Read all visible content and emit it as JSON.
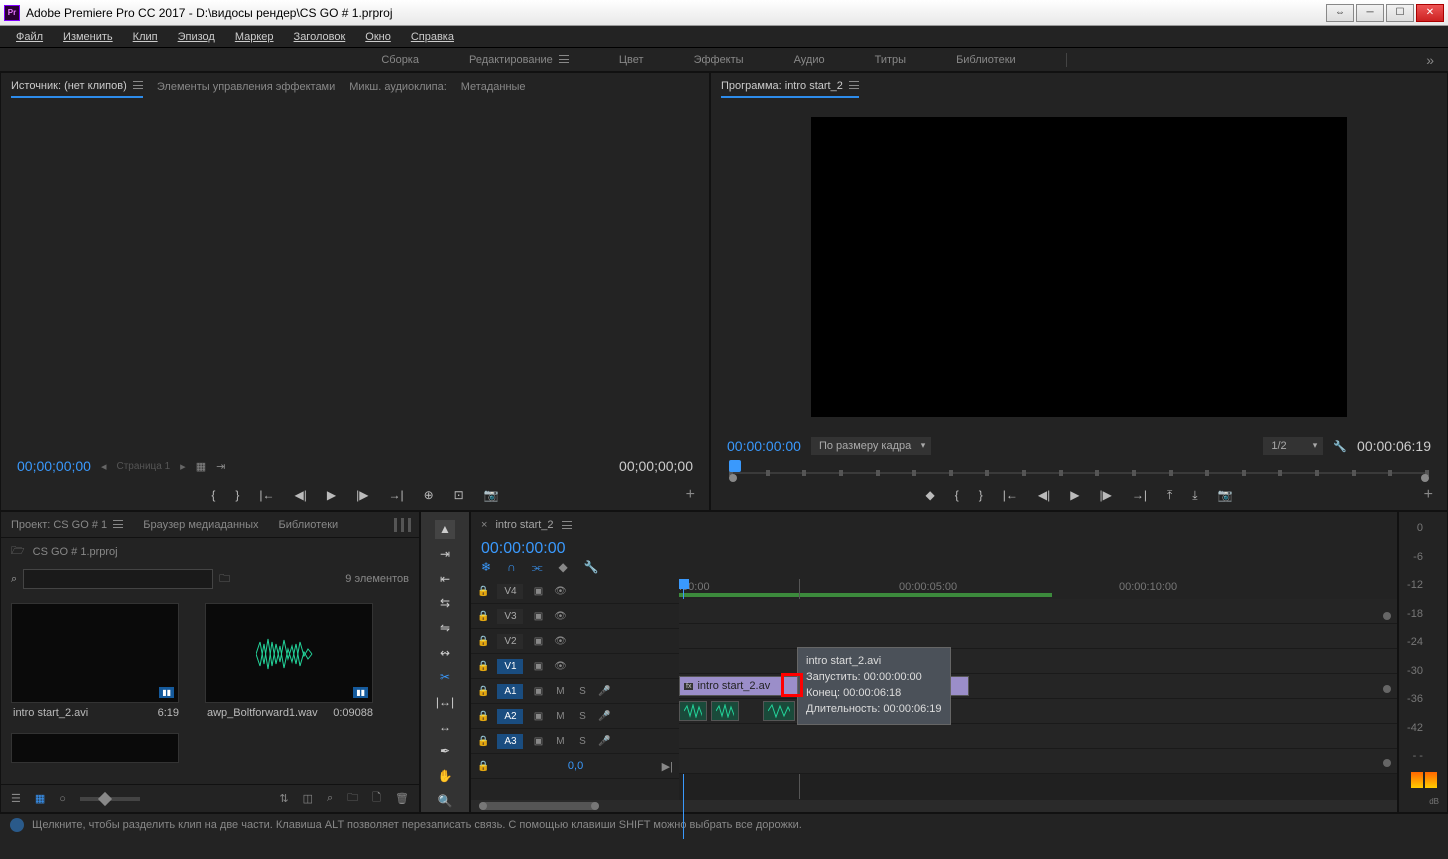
{
  "app": {
    "title": "Adobe Premiere Pro CC 2017 - D:\\видосы рендер\\CS GO # 1.prproj",
    "logo": "Pr"
  },
  "menubar": [
    "Файл",
    "Изменить",
    "Клип",
    "Эпизод",
    "Маркер",
    "Заголовок",
    "Окно",
    "Справка"
  ],
  "workspaces": [
    "Сборка",
    "Редактирование",
    "Цвет",
    "Эффекты",
    "Аудио",
    "Титры",
    "Библиотеки"
  ],
  "workspace_active": 1,
  "source_panel": {
    "tabs": [
      "Источник: (нет клипов)",
      "Элементы управления эффектами",
      "Микш. аудиоклипа:",
      "Метаданные"
    ],
    "tc_left": "00;00;00;00",
    "page": "Страница 1",
    "tc_right": "00;00;00;00"
  },
  "program_panel": {
    "label": "Программа: intro start_2",
    "tc_left": "00:00:00:00",
    "fit": "По размеру кадра",
    "res": "1/2",
    "tc_right": "00:00:06:19"
  },
  "project": {
    "tabs": [
      "Проект: CS GO # 1",
      "Браузер медиаданных",
      "Библиотеки"
    ],
    "file": "CS GO # 1.prproj",
    "count": "9 элементов",
    "clips": [
      {
        "name": "intro start_2.avi",
        "dur": "6:19",
        "badge": "▮▮"
      },
      {
        "name": "awp_Boltforward1.wav",
        "dur": "0:09088",
        "badge": "▮▮"
      }
    ]
  },
  "timeline": {
    "seq": "intro start_2",
    "tc": "00:00:00:00",
    "ticks": [
      ":00:00",
      "00:00:05:00",
      "00:00:10:00"
    ],
    "video_tracks": [
      "V4",
      "V3",
      "V2",
      "V1"
    ],
    "audio_tracks": [
      "A1",
      "A2",
      "A3"
    ],
    "zoom": "0,0",
    "clip_name": "intro start_2.av"
  },
  "tooltip": {
    "name": "intro start_2.avi",
    "start_lbl": "Запустить:",
    "start": "00:00:00:00",
    "end_lbl": "Конец:",
    "end": "00:00:06:18",
    "dur_lbl": "Длительность:",
    "dur": "00:00:06:19"
  },
  "meters": {
    "scale": [
      "0",
      "-6",
      "-12",
      "-18",
      "-24",
      "-30",
      "-36",
      "-42",
      "- -"
    ],
    "unit": "dB"
  },
  "status": "Щелкните, чтобы разделить клип на две части. Клавиша ALT позволяет перезаписать связь. С помощью клавиши SHIFT можно выбрать все дорожки."
}
